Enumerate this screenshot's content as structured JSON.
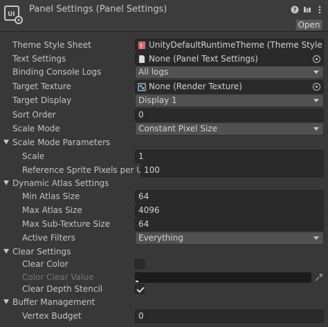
{
  "header": {
    "title": "Panel Settings (Panel Settings)",
    "open_label": "Open",
    "icons": [
      "help-icon",
      "preset-icon",
      "menu-icon"
    ]
  },
  "rows": {
    "theme_style_sheet": {
      "label": "Theme Style Sheet",
      "value": "UnityDefaultRuntimeTheme (Theme Style She"
    },
    "text_settings": {
      "label": "Text Settings",
      "value": "None (Panel Text Settings)"
    },
    "binding_console_logs": {
      "label": "Binding Console Logs",
      "value": "All logs"
    },
    "target_texture": {
      "label": "Target Texture",
      "value": "None (Render Texture)"
    },
    "target_display": {
      "label": "Target Display",
      "value": "Display 1"
    },
    "sort_order": {
      "label": "Sort Order",
      "value": "0"
    },
    "scale_mode": {
      "label": "Scale Mode",
      "value": "Constant Pixel Size"
    },
    "scale_mode_parameters": {
      "label": "Scale Mode Parameters"
    },
    "scale": {
      "label": "Scale",
      "value": "1"
    },
    "reference_sprite_ppu": {
      "label": "Reference Sprite Pixels per Unit",
      "value": "100"
    },
    "dynamic_atlas_settings": {
      "label": "Dynamic Atlas Settings"
    },
    "min_atlas_size": {
      "label": "Min Atlas Size",
      "value": "64"
    },
    "max_atlas_size": {
      "label": "Max Atlas Size",
      "value": "4096"
    },
    "max_sub_texture_size": {
      "label": "Max Sub-Texture Size",
      "value": "64"
    },
    "active_filters": {
      "label": "Active Filters",
      "value": "Everything"
    },
    "clear_settings": {
      "label": "Clear Settings"
    },
    "clear_color": {
      "label": "Clear Color",
      "checked": false
    },
    "color_clear_value": {
      "label": "Color Clear Value",
      "color": "#000000"
    },
    "clear_depth_stencil": {
      "label": "Clear Depth Stencil",
      "checked": true
    },
    "buffer_management": {
      "label": "Buffer Management"
    },
    "vertex_budget": {
      "label": "Vertex Budget",
      "value": "0"
    }
  },
  "colors": {
    "background": "#383838",
    "field": "#2a2a2a",
    "dropdown": "#515151",
    "text": "#c4c4c4"
  }
}
